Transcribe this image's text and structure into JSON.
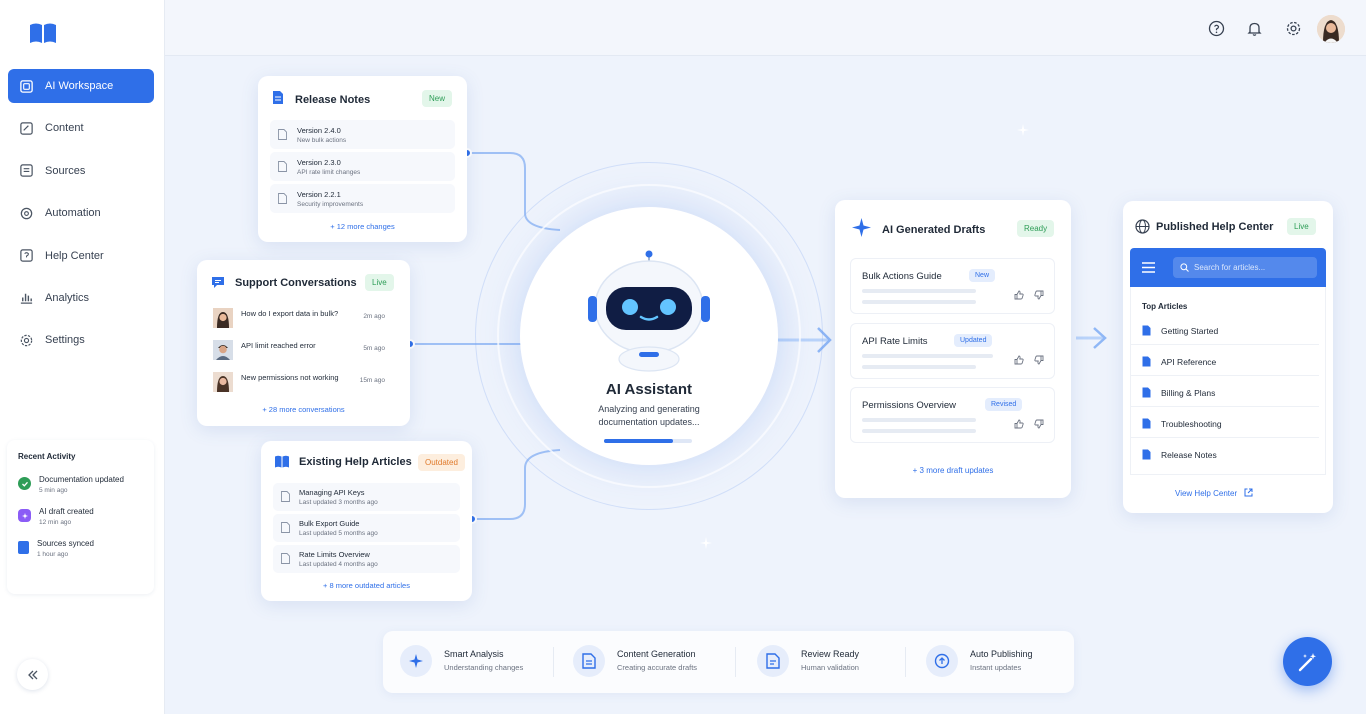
{
  "sidebar": {
    "items": [
      {
        "label": "AI Workspace",
        "icon": "workspace-icon",
        "active": true
      },
      {
        "label": "Content",
        "icon": "content-icon"
      },
      {
        "label": "Sources",
        "icon": "sources-icon"
      },
      {
        "label": "Automation",
        "icon": "automation-icon"
      },
      {
        "label": "Help Center",
        "icon": "help-center-icon"
      },
      {
        "label": "Analytics",
        "icon": "analytics-icon"
      },
      {
        "label": "Settings",
        "icon": "settings-icon"
      }
    ],
    "recent_activity": {
      "title": "Recent Activity",
      "items": [
        {
          "label": "Documentation updated",
          "time": "5 min ago",
          "color": "#2e9d57"
        },
        {
          "label": "AI draft created",
          "time": "12 min ago",
          "color": "#8b5cf6"
        },
        {
          "label": "Sources synced",
          "time": "1 hour ago",
          "color": "#2f6fe8"
        }
      ]
    }
  },
  "release_notes": {
    "title": "Release Notes",
    "badge": "New",
    "items": [
      {
        "version": "Version 2.4.0",
        "desc": "New bulk actions"
      },
      {
        "version": "Version 2.3.0",
        "desc": "API rate limit changes"
      },
      {
        "version": "Version 2.2.1",
        "desc": "Security improvements"
      }
    ],
    "more": "+ 12 more changes"
  },
  "support": {
    "title": "Support Conversations",
    "badge": "Live",
    "items": [
      {
        "text": "How do I export data in bulk?",
        "time": "2m ago"
      },
      {
        "text": "API limit reached error",
        "time": "5m ago"
      },
      {
        "text": "New permissions not working",
        "time": "15m ago"
      }
    ],
    "more": "+ 28 more conversations"
  },
  "existing": {
    "title": "Existing Help Articles",
    "badge": "Outdated",
    "items": [
      {
        "title": "Managing API Keys",
        "updated": "Last updated 3 months ago"
      },
      {
        "title": "Bulk Export Guide",
        "updated": "Last updated 5 months ago"
      },
      {
        "title": "Rate Limits Overview",
        "updated": "Last updated 4 months ago"
      }
    ],
    "more": "+ 8 more outdated articles"
  },
  "assistant": {
    "title": "AI Assistant",
    "status": "Analyzing and generating documentation updates...",
    "progress": 0.78
  },
  "drafts": {
    "title": "AI Generated Drafts",
    "badge": "Ready",
    "items": [
      {
        "label": "Bulk Actions Guide",
        "tag": "New"
      },
      {
        "label": "API Rate Limits",
        "tag": "Updated"
      },
      {
        "label": "Permissions Overview",
        "tag": "Revised"
      }
    ],
    "more": "+ 3 more draft updates"
  },
  "published": {
    "title": "Published Help Center",
    "badge": "Live",
    "search_placeholder": "Search for articles...",
    "section": "Top Articles",
    "items": [
      "Getting Started",
      "API Reference",
      "Billing & Plans",
      "Troubleshooting",
      "Release Notes"
    ],
    "link": "View Help Center"
  },
  "features": [
    {
      "title": "Smart Analysis",
      "sub": "Understanding changes"
    },
    {
      "title": "Content Generation",
      "sub": "Creating accurate drafts"
    },
    {
      "title": "Review Ready",
      "sub": "Human validation"
    },
    {
      "title": "Auto Publishing",
      "sub": "Instant updates"
    }
  ],
  "colors": {
    "accent": "#2f6fe8",
    "green": "#2e9d57",
    "orange": "#e07a2b"
  }
}
